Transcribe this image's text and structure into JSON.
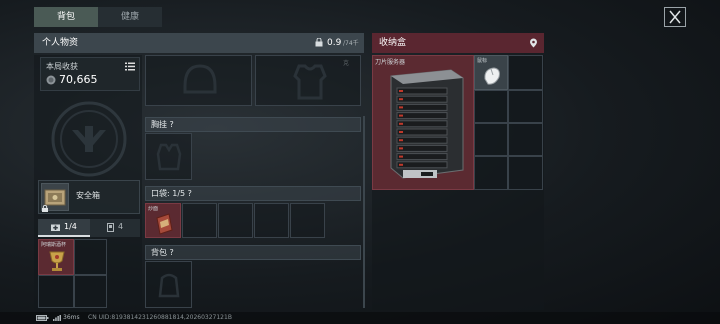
{
  "tabs": [
    {
      "label": "背包"
    },
    {
      "label": "健康"
    }
  ],
  "personal": {
    "title": "个人物资",
    "weight_value": "0.9",
    "weight_unit": "/74千克",
    "earnings_label": "本局收获",
    "earnings_value": "70,665",
    "safe_box_label": "安全箱",
    "tab_med_count": "1/4",
    "tab_ammo_count": "4",
    "item_label": "阿瑞斯酒杯"
  },
  "loadout": {
    "chest_rig_label": "胸挂 ?",
    "pockets_label": "口袋: 1/5 ?",
    "pocket_item_label": "炒面",
    "backpack_label": "背包 ?"
  },
  "storage": {
    "title": "收纳盒",
    "server_label": "刀片服务器",
    "mouse_label": "鼠标"
  },
  "status_bar": {
    "ping": "36ms",
    "build_info": "CN UID:8193814231260881814,20260327121B"
  },
  "colors": {
    "accent_green": "#4a5a55",
    "storage_red": "#5a2630",
    "highlight_red": "#5b2a31"
  }
}
